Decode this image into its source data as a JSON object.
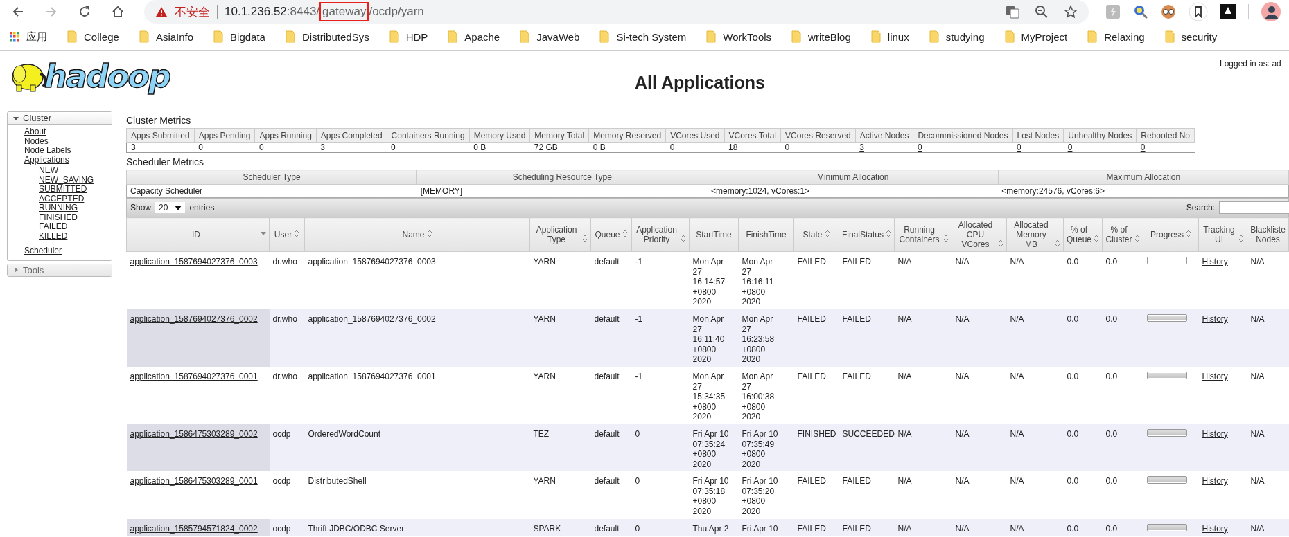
{
  "browser": {
    "forward_disabled": true,
    "url": {
      "warning": "不安全",
      "host": "10.1.236.52",
      "port": ":8443",
      "before": "/",
      "highlighted": "gateway",
      "after": "/ocdp/yarn"
    },
    "bookmarks": [
      {
        "kind": "apps",
        "label": "应用"
      },
      {
        "kind": "folder",
        "label": "College"
      },
      {
        "kind": "folder",
        "label": "AsiaInfo"
      },
      {
        "kind": "folder",
        "label": "Bigdata"
      },
      {
        "kind": "folder",
        "label": "DistributedSys"
      },
      {
        "kind": "folder",
        "label": "HDP"
      },
      {
        "kind": "folder",
        "label": "Apache"
      },
      {
        "kind": "folder",
        "label": "JavaWeb"
      },
      {
        "kind": "folder",
        "label": "Si-tech System"
      },
      {
        "kind": "folder",
        "label": "WorkTools"
      },
      {
        "kind": "folder",
        "label": "writeBlog"
      },
      {
        "kind": "folder",
        "label": "linux"
      },
      {
        "kind": "folder",
        "label": "studying"
      },
      {
        "kind": "folder",
        "label": "MyProject"
      },
      {
        "kind": "folder",
        "label": "Relaxing"
      },
      {
        "kind": "folder",
        "label": "security"
      }
    ]
  },
  "header": {
    "logo": "hadoop",
    "title": "All Applications",
    "logged_in": "Logged in as: ad"
  },
  "sidebar": [
    {
      "label": "Cluster",
      "expanded": true,
      "children": [
        {
          "label": "About"
        },
        {
          "label": "Nodes"
        },
        {
          "label": "Node Labels"
        },
        {
          "label": "Applications",
          "children": [
            {
              "label": "NEW"
            },
            {
              "label": "NEW_SAVING"
            },
            {
              "label": "SUBMITTED"
            },
            {
              "label": "ACCEPTED"
            },
            {
              "label": "RUNNING"
            },
            {
              "label": "FINISHED"
            },
            {
              "label": "FAILED"
            },
            {
              "label": "KILLED"
            }
          ]
        },
        {
          "label": "Scheduler"
        }
      ]
    },
    {
      "label": "Tools",
      "expanded": false
    }
  ],
  "cluster_metrics": {
    "title": "Cluster Metrics",
    "metrics": [
      {
        "label": "Apps Submitted",
        "value": "3",
        "link": false
      },
      {
        "label": "Apps Pending",
        "value": "0",
        "link": false
      },
      {
        "label": "Apps Running",
        "value": "0",
        "link": false
      },
      {
        "label": "Apps Completed",
        "value": "3",
        "link": false
      },
      {
        "label": "Containers Running",
        "value": "0",
        "link": false
      },
      {
        "label": "Memory Used",
        "value": "0 B",
        "link": false
      },
      {
        "label": "Memory Total",
        "value": "72 GB",
        "link": false
      },
      {
        "label": "Memory Reserved",
        "value": "0 B",
        "link": false
      },
      {
        "label": "VCores Used",
        "value": "0",
        "link": false
      },
      {
        "label": "VCores Total",
        "value": "18",
        "link": false
      },
      {
        "label": "VCores Reserved",
        "value": "0",
        "link": false
      },
      {
        "label": "Active Nodes",
        "value": "3",
        "link": true
      },
      {
        "label": "Decommissioned Nodes",
        "value": "0",
        "link": true
      },
      {
        "label": "Lost Nodes",
        "value": "0",
        "link": true
      },
      {
        "label": "Unhealthy Nodes",
        "value": "0",
        "link": true
      },
      {
        "label": "Rebooted No",
        "value": "0",
        "link": true
      }
    ]
  },
  "scheduler_metrics": {
    "title": "Scheduler Metrics",
    "columns": [
      "Scheduler Type",
      "Scheduling Resource Type",
      "Minimum Allocation",
      "Maximum Allocation"
    ],
    "values": [
      "Capacity Scheduler",
      "[MEMORY]",
      "<memory:1024, vCores:1>",
      "<memory:24576, vCores:6>"
    ]
  },
  "entries": {
    "show": "Show",
    "page_size": "20",
    "entries": "entries",
    "search": "Search:"
  },
  "apps": {
    "columns": [
      {
        "label": "ID",
        "sorted": true,
        "sortable": true
      },
      {
        "label": "User",
        "sorted": false,
        "sortable": true
      },
      {
        "label": "Name",
        "sorted": false,
        "sortable": true
      },
      {
        "label": "Application Type",
        "sorted": false,
        "sortable": true
      },
      {
        "label": "Queue",
        "sorted": false,
        "sortable": true
      },
      {
        "label": "Application Priority",
        "sorted": false,
        "sortable": true
      },
      {
        "label": "StartTime",
        "sorted": false,
        "sortable": false
      },
      {
        "label": "FinishTime",
        "sorted": false,
        "sortable": false
      },
      {
        "label": "State",
        "sorted": false,
        "sortable": true
      },
      {
        "label": "FinalStatus",
        "sorted": false,
        "sortable": true
      },
      {
        "label": "Running Containers",
        "sorted": false,
        "sortable": true
      },
      {
        "label": "Allocated CPU VCores",
        "sorted": false,
        "sortable": true
      },
      {
        "label": "Allocated Memory MB",
        "sorted": false,
        "sortable": true
      },
      {
        "label": "% of Queue",
        "sorted": false,
        "sortable": true
      },
      {
        "label": "% of Cluster",
        "sorted": false,
        "sortable": true
      },
      {
        "label": "Progress",
        "sorted": false,
        "sortable": true
      },
      {
        "label": "Tracking UI",
        "sorted": false,
        "sortable": true
      },
      {
        "label": "Blackliste Nodes",
        "sorted": false,
        "sortable": false
      }
    ],
    "rows": [
      {
        "id": "application_1587694027376_0003",
        "user": "dr.who",
        "name": "application_1587694027376_0003",
        "type": "YARN",
        "queue": "default",
        "priority": "-1",
        "start": "Mon Apr\n27\n16:14:57\n+0800\n2020",
        "finish": "Mon Apr\n27\n16:16:11\n+0800\n2020",
        "state": "FAILED",
        "final_status": "FAILED",
        "containers": "N/A",
        "cpu": "N/A",
        "memory": "N/A",
        "pct_queue": "0.0",
        "pct_cluster": "0.0",
        "level": 0,
        "tracking": "History",
        "blacklisted": "N/A"
      },
      {
        "id": "application_1587694027376_0002",
        "user": "dr.who",
        "name": "application_1587694027376_0002",
        "type": "YARN",
        "queue": "default",
        "priority": "-1",
        "start": "Mon Apr\n27\n16:11:40\n+0800\n2020",
        "finish": "Mon Apr\n27\n16:23:58\n+0800\n2020",
        "state": "FAILED",
        "final_status": "FAILED",
        "containers": "N/A",
        "cpu": "N/A",
        "memory": "N/A",
        "pct_queue": "0.0",
        "pct_cluster": "0.0",
        "level": 1,
        "tracking": "History",
        "blacklisted": "N/A"
      },
      {
        "id": "application_1587694027376_0001",
        "user": "dr.who",
        "name": "application_1587694027376_0001",
        "type": "YARN",
        "queue": "default",
        "priority": "-1",
        "start": "Mon Apr\n27\n15:34:35\n+0800\n2020",
        "finish": "Mon Apr\n27\n16:00:38\n+0800\n2020",
        "state": "FAILED",
        "final_status": "FAILED",
        "containers": "N/A",
        "cpu": "N/A",
        "memory": "N/A",
        "pct_queue": "0.0",
        "pct_cluster": "0.0",
        "level": 1,
        "tracking": "History",
        "blacklisted": "N/A"
      },
      {
        "id": "application_1586475303289_0002",
        "user": "ocdp",
        "name": "OrderedWordCount",
        "type": "TEZ",
        "queue": "default",
        "priority": "0",
        "start": "Fri Apr 10\n07:35:24\n+0800\n2020",
        "finish": "Fri Apr 10\n07:35:49\n+0800\n2020",
        "state": "FINISHED",
        "final_status": "SUCCEEDED",
        "containers": "N/A",
        "cpu": "N/A",
        "memory": "N/A",
        "pct_queue": "0.0",
        "pct_cluster": "0.0",
        "level": 1,
        "tracking": "History",
        "blacklisted": "N/A"
      },
      {
        "id": "application_1586475303289_0001",
        "user": "ocdp",
        "name": "DistributedShell",
        "type": "YARN",
        "queue": "default",
        "priority": "0",
        "start": "Fri Apr 10\n07:35:18\n+0800\n2020",
        "finish": "Fri Apr 10\n07:35:20\n+0800\n2020",
        "state": "FAILED",
        "final_status": "FAILED",
        "containers": "N/A",
        "cpu": "N/A",
        "memory": "N/A",
        "pct_queue": "0.0",
        "pct_cluster": "0.0",
        "level": 1,
        "tracking": "History",
        "blacklisted": "N/A"
      },
      {
        "id": "application_1585794571824_0002",
        "user": "ocdp",
        "name": "Thrift JDBC/ODBC Server",
        "type": "SPARK",
        "queue": "default",
        "priority": "0",
        "start": "Thu Apr 2",
        "finish": "Fri Apr 10",
        "state": "FAILED",
        "final_status": "FAILED",
        "containers": "N/A",
        "cpu": "N/A",
        "memory": "N/A",
        "pct_queue": "0.0",
        "pct_cluster": "0.0",
        "level": 1,
        "tracking": "History",
        "blacklisted": "N/A"
      }
    ]
  }
}
